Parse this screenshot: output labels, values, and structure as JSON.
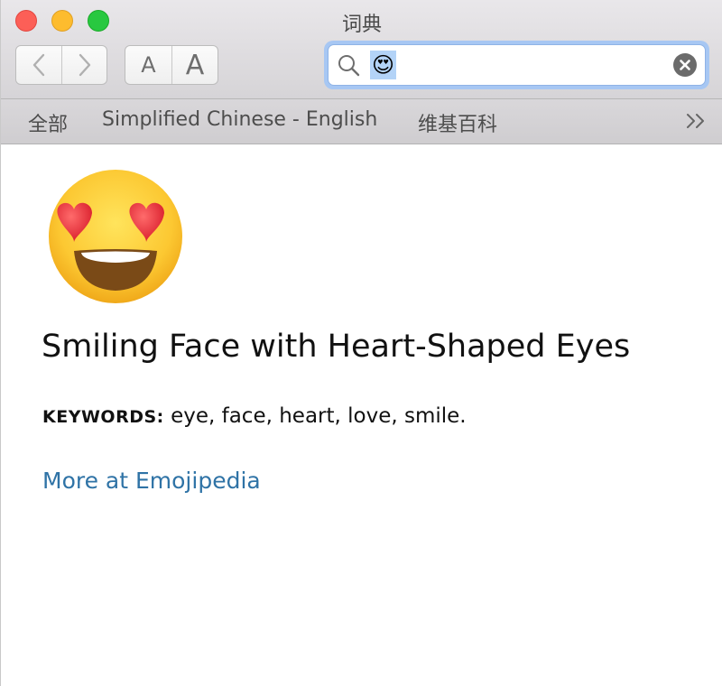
{
  "window": {
    "title": "词典"
  },
  "toolbar": {
    "font_small_label": "A",
    "font_large_label": "A"
  },
  "search": {
    "value": "😍"
  },
  "scope": {
    "items": [
      {
        "label": "全部"
      },
      {
        "label": "Simplified Chinese - English"
      },
      {
        "label": "维基百科"
      }
    ],
    "more_label": ">>"
  },
  "entry": {
    "title": "Smiling Face with Heart-Shaped Eyes",
    "keywords_label": "KEYWORDS:",
    "keywords": "eye, face, heart, love, smile.",
    "more_link": "More at Emojipedia"
  },
  "colors": {
    "link": "#2f73a6",
    "search_focus": "#a7c7f3",
    "close": "#fc5f57",
    "minimize": "#fdbc2e",
    "zoom": "#28c840"
  },
  "icons": {
    "back": "chevron-left-icon",
    "forward": "chevron-right-icon",
    "search": "magnifier-icon",
    "clear": "clear-circle-icon",
    "more": "double-chevron-right-icon"
  }
}
